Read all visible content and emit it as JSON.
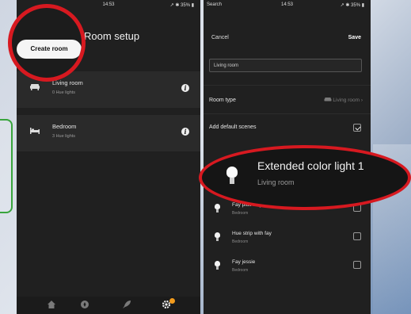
{
  "left_phone": {
    "status_time": "14:53",
    "status_right": "↗ ✱ 35% ▮",
    "title": "Room setup",
    "create_button": "Create room",
    "rooms": [
      {
        "name": "Living room",
        "sub": "0 Hue lights"
      },
      {
        "name": "Bedroom",
        "sub": "3 Hue lights"
      }
    ],
    "info_glyph": "i",
    "tabs": [
      "home-icon",
      "explore-icon",
      "rocket-icon",
      "settings-icon"
    ]
  },
  "right_phone": {
    "status_left": "Search",
    "status_time": "14:53",
    "status_right": "↗ ✱ 35% ▮",
    "cancel": "Cancel",
    "save": "Save",
    "room_name_value": "Living room",
    "room_type_label": "Room type",
    "room_type_value": "Living room",
    "default_scenes_label": "Add default scenes",
    "default_scenes_checked": true,
    "highlight": {
      "name": "Extended color light 1",
      "room": "Living room"
    },
    "lights": [
      {
        "name": "Fay plus kaly",
        "room": "Bedroom"
      },
      {
        "name": "Hue strip with fay",
        "room": "Bedroom"
      },
      {
        "name": "Fay jessie",
        "room": "Bedroom"
      }
    ]
  },
  "colors": {
    "highlight_red": "#d71920",
    "badge_orange": "#f29b1d",
    "app_dark": "#202020"
  }
}
